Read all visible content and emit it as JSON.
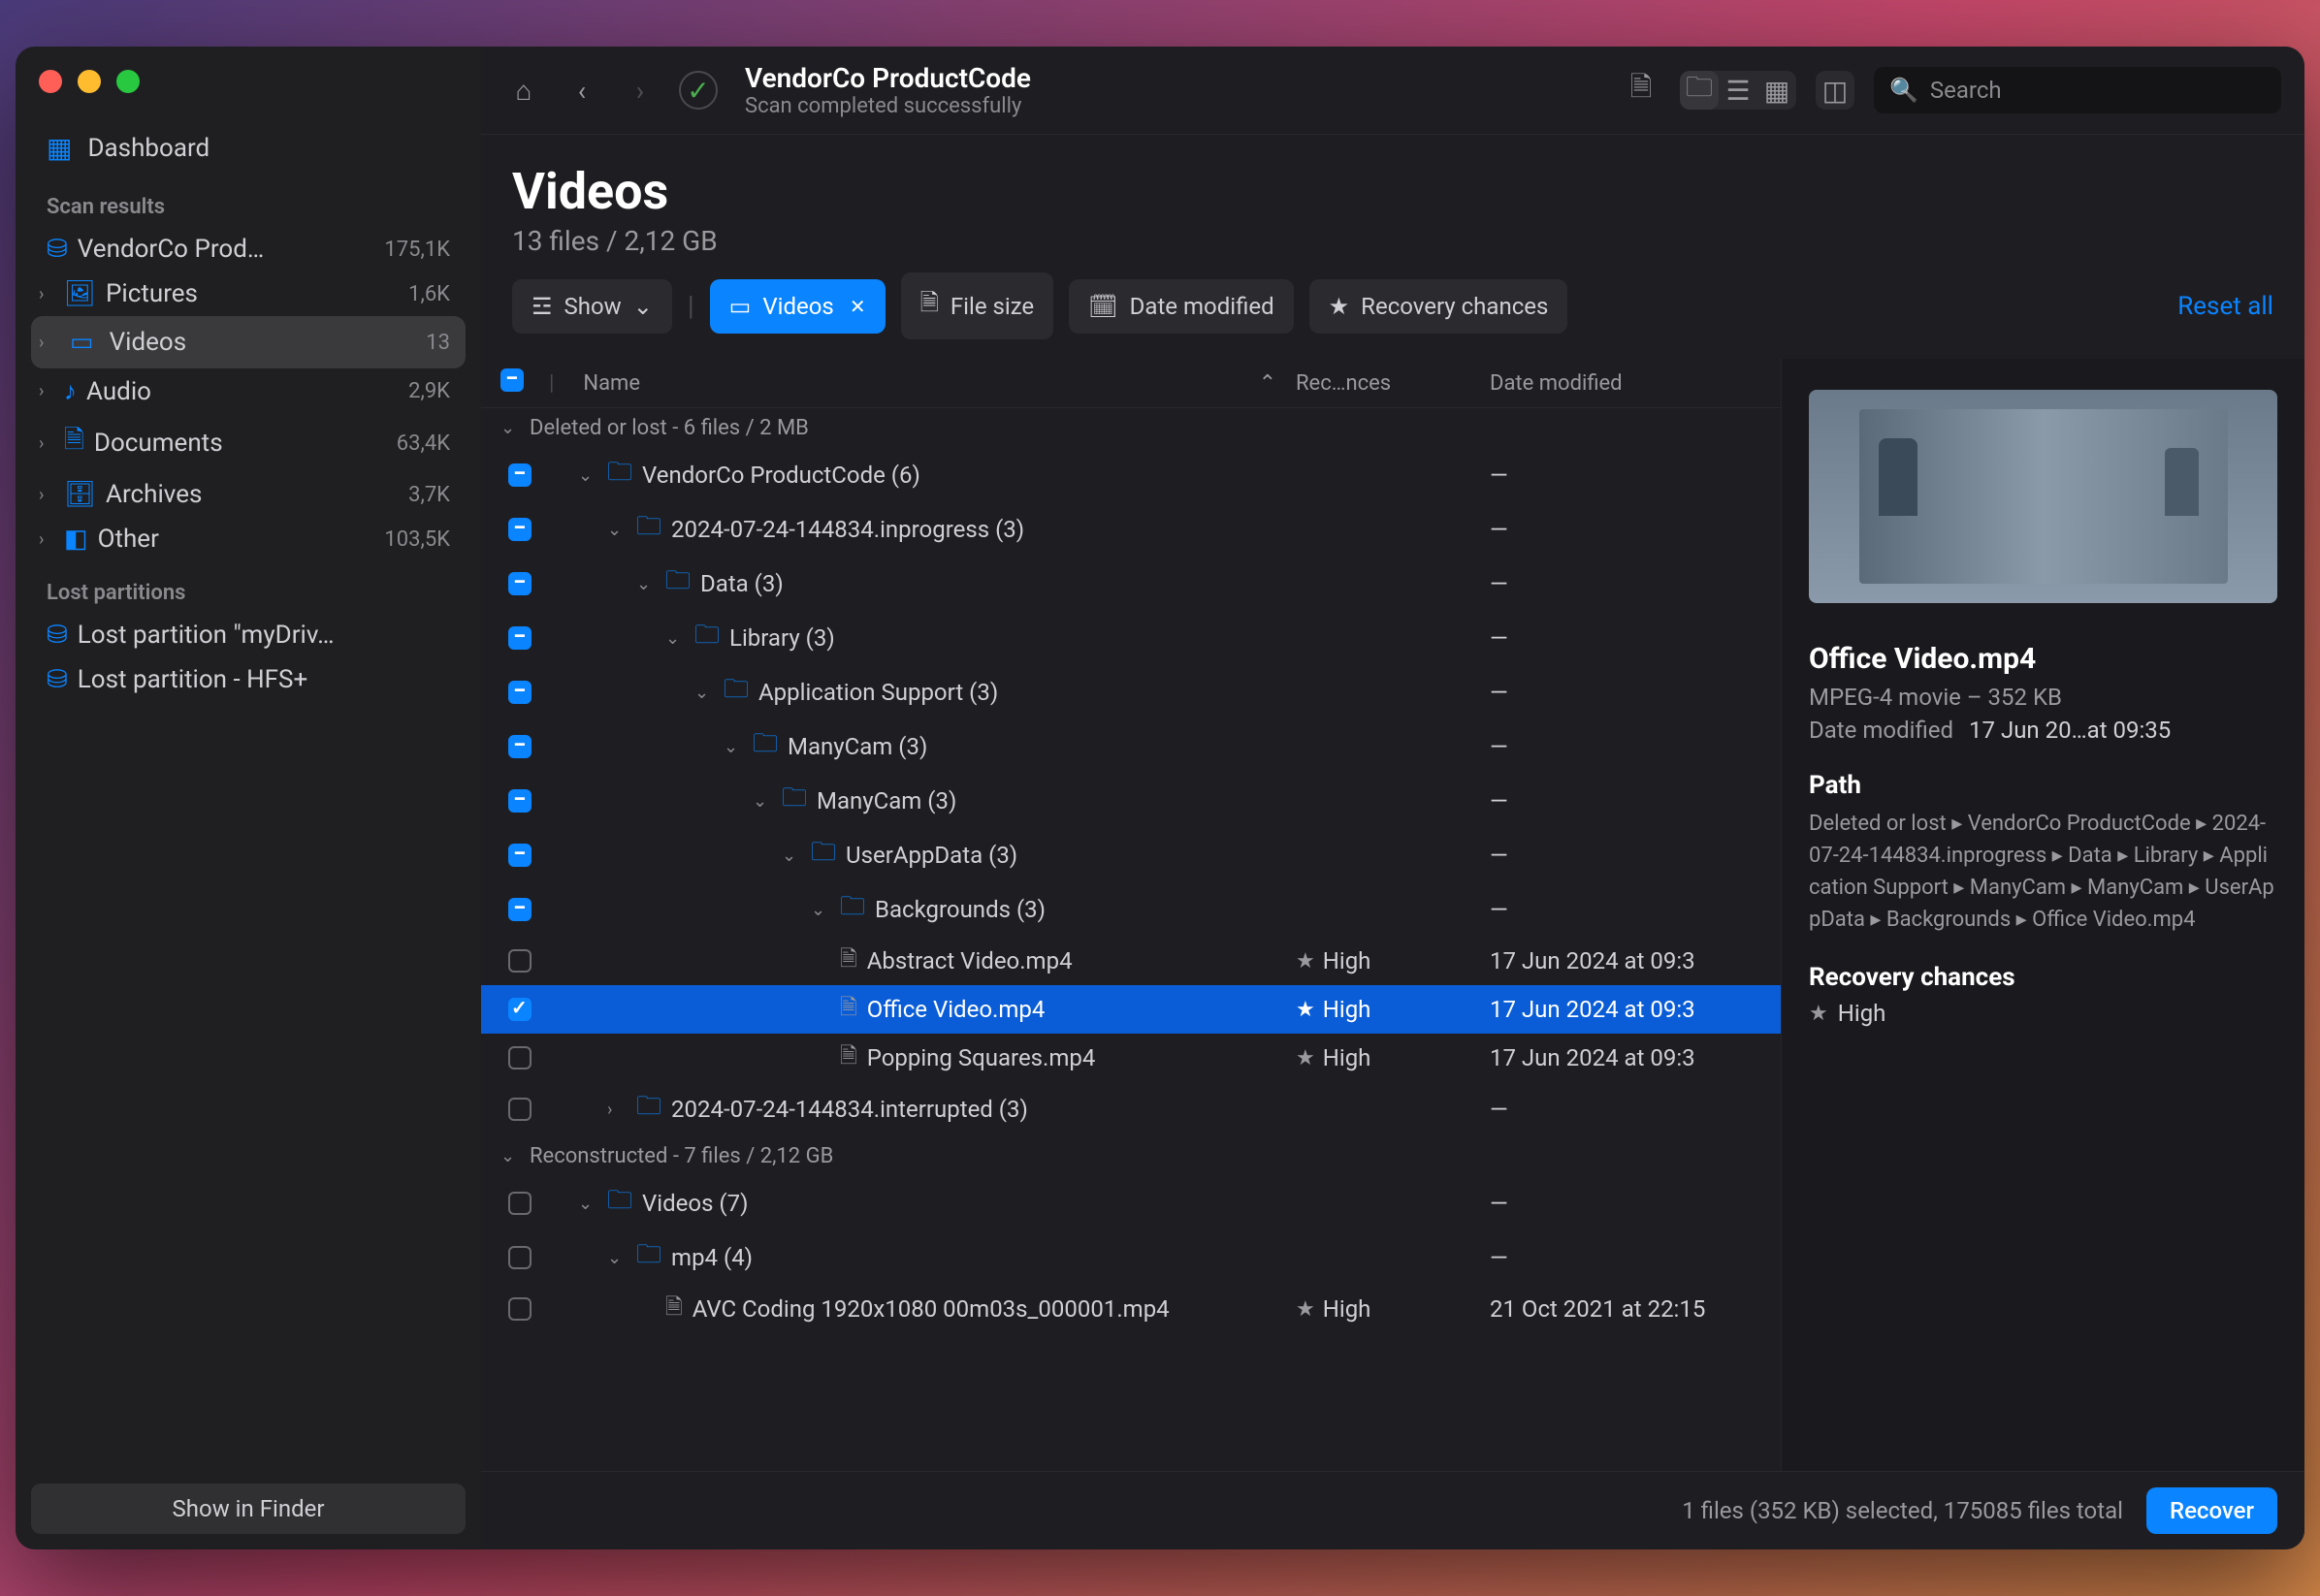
{
  "window": {
    "title": "VendorCo ProductCode",
    "subtitle": "Scan completed successfully"
  },
  "search": {
    "placeholder": "Search"
  },
  "sidebar": {
    "dashboard": "Dashboard",
    "scan_results_label": "Scan results",
    "items": [
      {
        "label": "VendorCo Prod…",
        "count": "175,1K",
        "icon": "disk"
      },
      {
        "label": "Pictures",
        "count": "1,6K",
        "icon": "picture"
      },
      {
        "label": "Videos",
        "count": "13",
        "icon": "video",
        "selected": true
      },
      {
        "label": "Audio",
        "count": "2,9K",
        "icon": "audio"
      },
      {
        "label": "Documents",
        "count": "63,4K",
        "icon": "document"
      },
      {
        "label": "Archives",
        "count": "3,7K",
        "icon": "archive"
      },
      {
        "label": "Other",
        "count": "103,5K",
        "icon": "other"
      }
    ],
    "lost_label": "Lost partitions",
    "lost": [
      {
        "label": "Lost partition \"myDriv…"
      },
      {
        "label": "Lost partition - HFS+"
      }
    ],
    "show_in_finder": "Show in Finder"
  },
  "header": {
    "title": "Videos",
    "subtitle": "13 files / 2,12 GB"
  },
  "filters": {
    "show": "Show",
    "videos": "Videos",
    "file_size": "File size",
    "date_modified": "Date modified",
    "recovery_chances": "Recovery chances",
    "reset_all": "Reset all"
  },
  "columns": {
    "name": "Name",
    "rec": "Rec…nces",
    "date": "Date modified"
  },
  "groups": [
    {
      "label": "Deleted or lost - 6 files / 2 MB"
    }
  ],
  "rows": [
    {
      "indent": 1,
      "type": "folder",
      "check": "on",
      "name": "VendorCo ProductCode (6)",
      "date": "—"
    },
    {
      "indent": 2,
      "type": "folder",
      "check": "on",
      "name": "2024-07-24-144834.inprogress (3)",
      "date": "—"
    },
    {
      "indent": 3,
      "type": "folder",
      "check": "on",
      "name": "Data (3)",
      "date": "—"
    },
    {
      "indent": 4,
      "type": "folder",
      "check": "on",
      "name": "Library (3)",
      "date": "—"
    },
    {
      "indent": 5,
      "type": "folder",
      "check": "on",
      "name": "Application Support (3)",
      "date": "—"
    },
    {
      "indent": 6,
      "type": "folder",
      "check": "on",
      "name": "ManyCam (3)",
      "date": "—"
    },
    {
      "indent": 7,
      "type": "folder",
      "check": "on",
      "name": "ManyCam (3)",
      "date": "—"
    },
    {
      "indent": 8,
      "type": "folder",
      "check": "on",
      "name": "UserAppData (3)",
      "date": "—"
    },
    {
      "indent": 9,
      "type": "folder",
      "check": "on",
      "name": "Backgrounds (3)",
      "date": "—"
    },
    {
      "indent": 9,
      "type": "file",
      "check": "off",
      "name": "Abstract Video.mp4",
      "rec": "High",
      "date": "17 Jun 2024 at 09:3"
    },
    {
      "indent": 9,
      "type": "file",
      "check": "check",
      "sel": true,
      "name": "Office Video.mp4",
      "rec": "High",
      "date": "17 Jun 2024 at 09:3"
    },
    {
      "indent": 9,
      "type": "file",
      "check": "off",
      "name": "Popping Squares.mp4",
      "rec": "High",
      "date": "17 Jun 2024 at 09:3"
    },
    {
      "indent": 2,
      "type": "folder",
      "check": "off",
      "arrow": "right",
      "name": "2024-07-24-144834.interrupted (3)",
      "date": "—"
    }
  ],
  "group2": {
    "label": "Reconstructed - 7 files / 2,12 GB"
  },
  "rows2": [
    {
      "indent": 1,
      "type": "folder",
      "check": "off",
      "name": "Videos (7)",
      "date": "—"
    },
    {
      "indent": 2,
      "type": "folder",
      "check": "off",
      "name": "mp4 (4)",
      "date": "—"
    },
    {
      "indent": 3,
      "type": "file",
      "check": "off",
      "name": "AVC Coding 1920x1080 00m03s_000001.mp4",
      "rec": "High",
      "date": "21 Oct 2021 at 22:15"
    }
  ],
  "preview": {
    "title": "Office Video.mp4",
    "kind": "MPEG-4 movie – 352 KB",
    "date_modified_label": "Date modified",
    "date_modified": "17 Jun 20…at 09:35",
    "path_label": "Path",
    "path": "Deleted or lost ▸ VendorCo ProductCode ▸ 2024-07-24-144834.inprogress ▸ Data ▸ Library ▸ Application Support ▸ ManyCam ▸ ManyCam ▸ UserAppData ▸ Backgrounds ▸ Office Video.mp4",
    "recovery_label": "Recovery chances",
    "recovery_value": "High"
  },
  "status": {
    "selection": "1 files (352 KB) selected, 175085 files total",
    "recover": "Recover"
  }
}
